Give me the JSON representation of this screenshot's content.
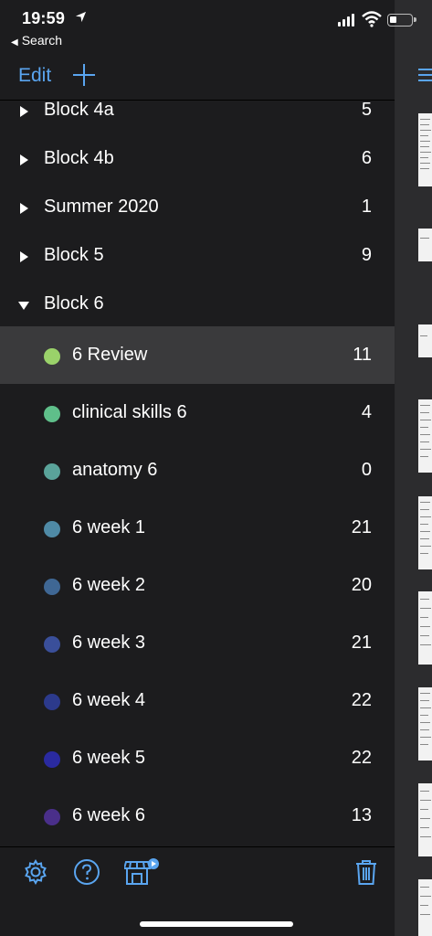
{
  "status_bar": {
    "time": "19:59",
    "back_app": "Search",
    "location_icon": "location-arrow-icon",
    "signal_icon": "cellular-signal-icon",
    "wifi_icon": "wifi-icon",
    "battery_icon": "battery-icon"
  },
  "toolbar": {
    "edit_label": "Edit",
    "add_icon": "plus-icon",
    "menu_icon": "list-menu-icon"
  },
  "colors": {
    "accent": "#5aa5f0",
    "background": "#1c1c1e",
    "selected_row": "#3a3a3c"
  },
  "list": {
    "folders": [
      {
        "label": "Block 4a",
        "count": "5",
        "expanded": false
      },
      {
        "label": "Block 4b",
        "count": "6",
        "expanded": false
      },
      {
        "label": "Summer 2020",
        "count": "1",
        "expanded": false
      },
      {
        "label": "Block 5",
        "count": "9",
        "expanded": false
      },
      {
        "label": "Block 6",
        "count": "",
        "expanded": true
      }
    ],
    "children": [
      {
        "label": "6 Review",
        "count": "11",
        "color": "#9ad26a",
        "selected": true
      },
      {
        "label": "clinical skills 6",
        "count": "4",
        "color": "#5fbf8a",
        "selected": false
      },
      {
        "label": "anatomy 6",
        "count": "0",
        "color": "#5aa39a",
        "selected": false
      },
      {
        "label": "6 week 1",
        "count": "21",
        "color": "#4f8aa6",
        "selected": false
      },
      {
        "label": "6 week 2",
        "count": "20",
        "color": "#3f6794",
        "selected": false
      },
      {
        "label": "6 week 3",
        "count": "21",
        "color": "#3a4f9a",
        "selected": false
      },
      {
        "label": "6 week 4",
        "count": "22",
        "color": "#2c3a8c",
        "selected": false
      },
      {
        "label": "6 week 5",
        "count": "22",
        "color": "#2a2aa0",
        "selected": false
      },
      {
        "label": "6 week 6",
        "count": "13",
        "color": "#4a2f8a",
        "selected": false
      }
    ]
  },
  "bottom_bar": {
    "settings_icon": "gear-icon",
    "help_icon": "question-circle-icon",
    "store_icon": "store-icon",
    "trash_icon": "trash-icon"
  }
}
